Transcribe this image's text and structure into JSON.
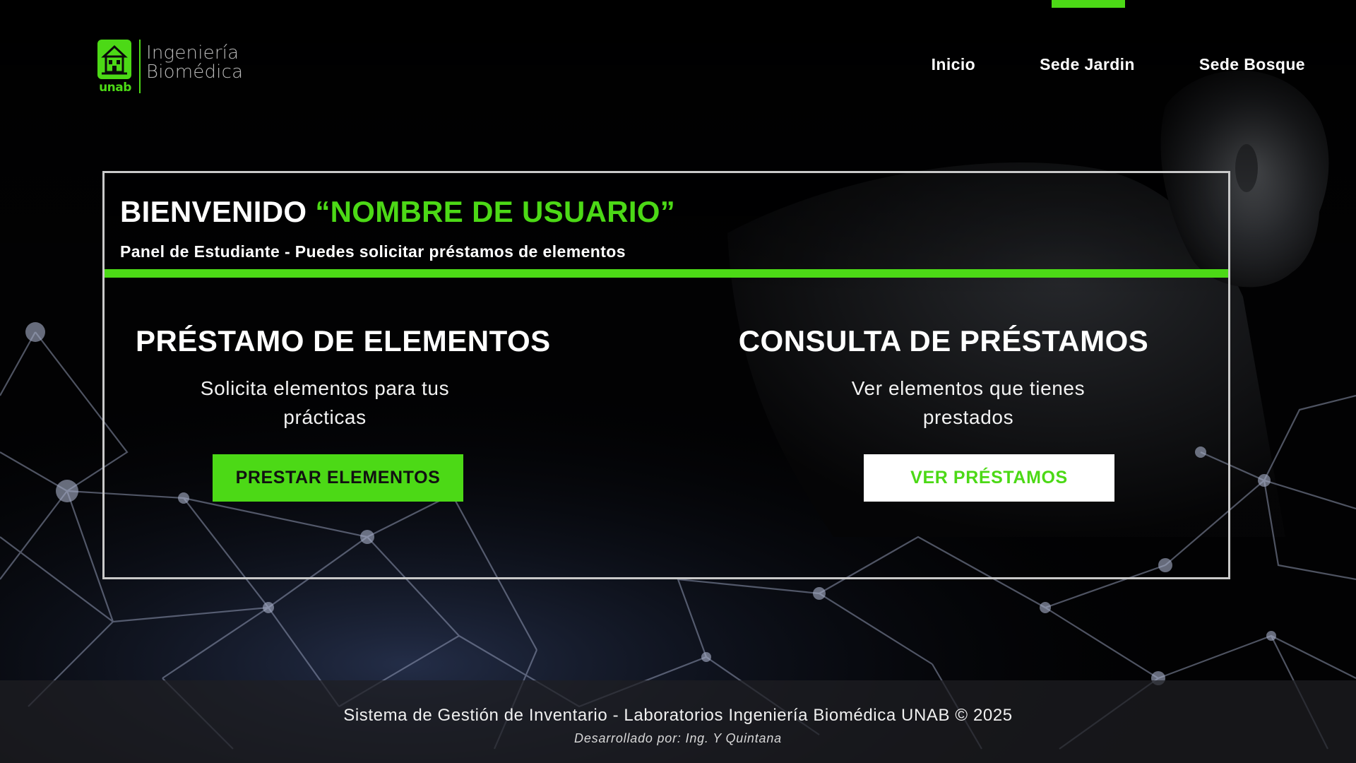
{
  "header": {
    "logo": {
      "line1": "Ingeniería",
      "line2": "Biomédica",
      "wordmark": "unab",
      "icon": "building-icon"
    },
    "nav": [
      {
        "label": "Inicio"
      },
      {
        "label": "Sede Jardin"
      },
      {
        "label": "Sede Bosque"
      }
    ],
    "active_nav": "Sede Jardin"
  },
  "panel": {
    "welcome_prefix": "BIENVENIDO",
    "user_name": "“NOMBRE DE USUARIO”",
    "subtitle": "Panel de Estudiante - Puedes solicitar préstamos de elementos"
  },
  "cards": {
    "loan": {
      "title": "PRÉSTAMO DE ELEMENTOS",
      "description": "Solicita elementos para tus prácticas",
      "button": "PRESTAR ELEMENTOS"
    },
    "query": {
      "title": "CONSULTA DE PRÉSTAMOS",
      "description": "Ver elementos que tienes prestados",
      "button": "VER PRÉSTAMOS"
    }
  },
  "footer": {
    "main": "Sistema de Gestión de Inventario - Laboratorios Ingeniería Biomédica UNAB © 2025",
    "credit": "Desarrollado por: Ing. Y Quintana"
  },
  "colors": {
    "accent": "#4cd916",
    "background": "#000000",
    "panel_border": "#c9c9c9",
    "footer_bg": "#1e1e22"
  }
}
